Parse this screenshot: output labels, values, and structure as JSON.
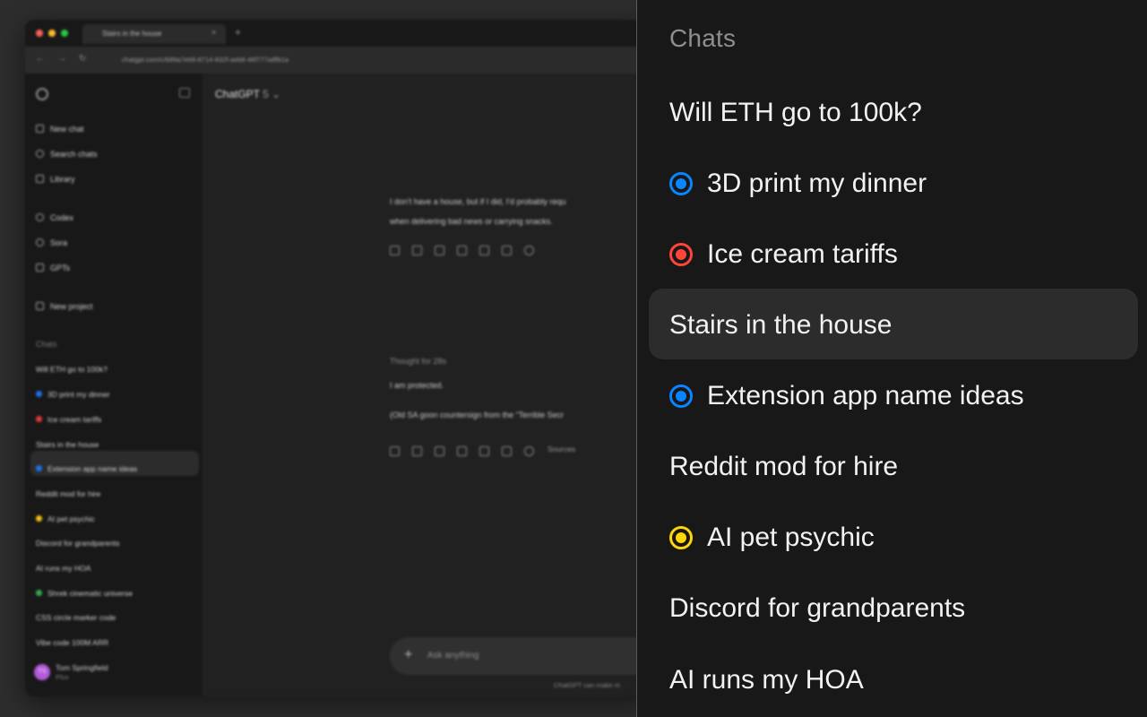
{
  "browser": {
    "tab_title": "Stairs in the house",
    "tab_close": "×",
    "new_tab": "+",
    "url": "chatgpt.com/c/689a7e68-8714-832f-aeb8-46f777a8fb1a",
    "back": "←",
    "forward": "→",
    "reload": "↻"
  },
  "sidebar": {
    "items": [
      {
        "label": "New chat",
        "icon": "new-chat-icon"
      },
      {
        "label": "Search chats",
        "icon": "search-icon"
      },
      {
        "label": "Library",
        "icon": "library-icon"
      },
      {
        "label": "Codex",
        "icon": "codex-icon"
      },
      {
        "label": "Sora",
        "icon": "sora-icon"
      },
      {
        "label": "GPTs",
        "icon": "gpts-icon"
      },
      {
        "label": "New project",
        "icon": "new-project-icon"
      }
    ],
    "chats_heading": "Chats",
    "chats": [
      {
        "label": "Will ETH go to 100k?",
        "dot": ""
      },
      {
        "label": "3D print my dinner",
        "dot": "#1a73e8"
      },
      {
        "label": "Ice cream tariffs",
        "dot": "#e53935"
      },
      {
        "label": "Stairs in the house",
        "dot": ""
      },
      {
        "label": "Extension app name ideas",
        "dot": "#1a73e8"
      },
      {
        "label": "Reddit mod for hire",
        "dot": ""
      },
      {
        "label": "AI pet psychic",
        "dot": "#f4c20d"
      },
      {
        "label": "Discord for grandparents",
        "dot": ""
      },
      {
        "label": "AI runs my HOA",
        "dot": ""
      },
      {
        "label": "Shrek cinematic universe",
        "dot": "#34a853"
      },
      {
        "label": "CSS circle marker code",
        "dot": ""
      },
      {
        "label": "Vibe code 100M ARR",
        "dot": ""
      }
    ],
    "user": {
      "name": "Tom Springfield",
      "plan": "Plus",
      "initials": "TS"
    }
  },
  "main": {
    "model_name": "ChatGPT",
    "model_version": "5 ⌄",
    "reply1_line1": "I don't have a house, but if I did, I'd probably requ",
    "reply1_line2": "when delivering bad news or carrying snacks.",
    "thought": "Thought for 28s",
    "reply2_line1": "I am protected.",
    "reply2_line2": "(Old SA goon countersign from the “Terrible Secr",
    "sources_label": "Sources",
    "composer_placeholder": "Ask anything",
    "composer_plus": "+",
    "disclaimer": "ChatGPT can make m"
  },
  "zoom_panel": {
    "heading": "Chats",
    "chats": [
      {
        "label": "Will ETH go to 100k?",
        "marker": "",
        "marker_color": ""
      },
      {
        "label": "3D print my dinner",
        "marker": "blue",
        "marker_color": "#0a84ff"
      },
      {
        "label": "Ice cream tariffs",
        "marker": "red",
        "marker_color": "#ff453a"
      },
      {
        "label": "Stairs in the house",
        "marker": "",
        "marker_color": "",
        "active": true
      },
      {
        "label": "Extension app name ideas",
        "marker": "blue",
        "marker_color": "#0a84ff"
      },
      {
        "label": "Reddit mod for hire",
        "marker": "",
        "marker_color": ""
      },
      {
        "label": "AI pet psychic",
        "marker": "yellow",
        "marker_color": "#ffd60a"
      },
      {
        "label": "Discord for grandparents",
        "marker": "",
        "marker_color": ""
      },
      {
        "label": "AI runs my HOA",
        "marker": "",
        "marker_color": ""
      }
    ]
  }
}
